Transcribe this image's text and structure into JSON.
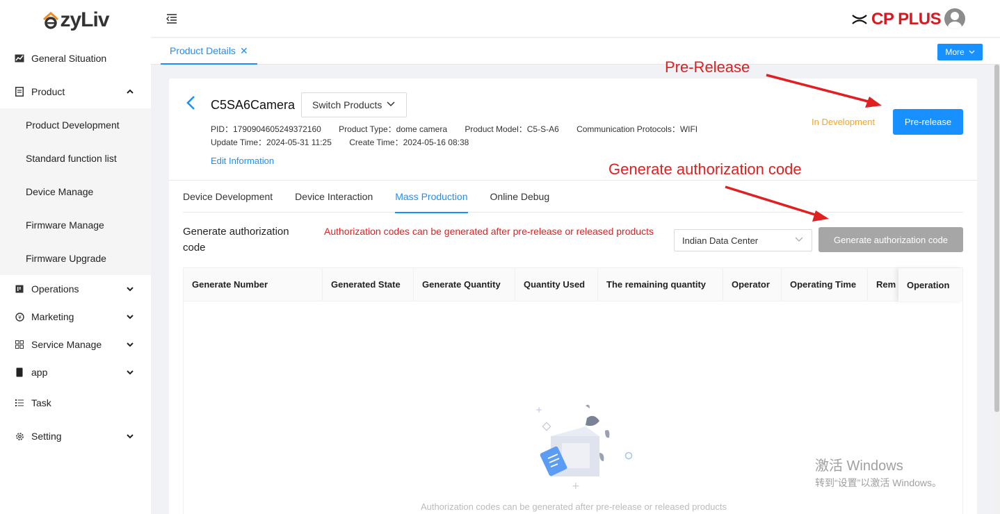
{
  "sidebar": {
    "logo": "ezyLiv",
    "items": [
      {
        "label": "General Situation"
      },
      {
        "label": "Product"
      },
      {
        "label": "Operations"
      },
      {
        "label": "Marketing"
      },
      {
        "label": "Service Manage"
      },
      {
        "label": "app"
      },
      {
        "label": "Task"
      },
      {
        "label": "Setting"
      }
    ],
    "product_sub": [
      "Product Development",
      "Standard function list",
      "Device Manage",
      "Firmware Manage",
      "Firmware Upgrade"
    ]
  },
  "topbar": {
    "brand": "CP PLUS"
  },
  "tabs": {
    "active": "Product Details",
    "more": "More"
  },
  "product": {
    "name": "C5SA6Camera",
    "switch_label": "Switch Products",
    "pid": "PID：1790904605249372160",
    "type": "Product Type：dome camera",
    "model": "Product Model：C5-S-A6",
    "protocol": "Communication Protocols：WIFI",
    "update_time": "Update Time：2024-05-31 11:25",
    "create_time": "Create Time：2024-05-16 08:38",
    "edit_link": "Edit Information",
    "status": "In Development",
    "pre_release": "Pre-release"
  },
  "inner_tabs": [
    "Device Development",
    "Device Interaction",
    "Mass Production",
    "Online Debug"
  ],
  "mass_production": {
    "label": "Generate authorization code",
    "note": "Authorization codes can be generated after pre-release or released products",
    "data_center": "Indian Data Center",
    "generate_button": "Generate authorization code",
    "columns": [
      "Generate Number",
      "Generated State",
      "Generate Quantity",
      "Quantity Used",
      "The remaining quantity",
      "Operator",
      "Operating Time",
      "Rem",
      "Operation"
    ],
    "empty_text": "Authorization codes can be generated after pre-release or released products"
  },
  "annotations": {
    "pre_release": "Pre-Release",
    "generate": "Generate authorization code",
    "color": "#e02020"
  },
  "watermark": {
    "line1": "激活 Windows",
    "line2": "转到“设置”以激活 Windows。"
  }
}
